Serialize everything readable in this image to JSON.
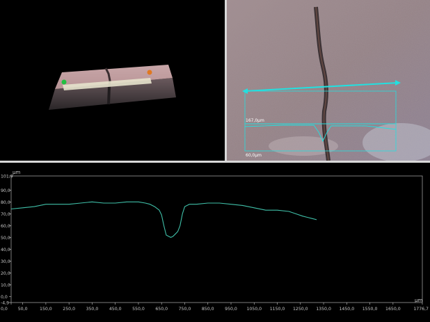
{
  "colors": {
    "profile_line": "#3fbfa8",
    "axis": "#c8c8c8",
    "measure_overlay": "#22e0e0",
    "marker_start": "#22c040",
    "marker_end": "#e07820"
  },
  "optical_view": {
    "label_width": "167,0μm",
    "label_height": "60,0μm"
  },
  "profile_chart": {
    "unit": "μm",
    "chart_data": {
      "type": "line",
      "xlim": [
        0,
        1776.7
      ],
      "ylim": [
        -4.9,
        101.9
      ],
      "x_ticks": [
        "0,0",
        "50,0",
        "150,0",
        "250,0",
        "350,0",
        "450,0",
        "550,0",
        "650,0",
        "750,0",
        "850,0",
        "950,0",
        "1050,0",
        "1150,0",
        "1250,0",
        "1350,0",
        "1450,0",
        "1550,0",
        "1650,0",
        "1776,7"
      ],
      "y_ticks": [
        "101,9",
        "90,0",
        "80,0",
        "70,0",
        "60,0",
        "50,0",
        "40,0",
        "30,0",
        "20,0",
        "10,0",
        "0,0",
        "-4,9"
      ],
      "series": [
        {
          "x": [
            0,
            50,
            100,
            150,
            200,
            250,
            300,
            350,
            400,
            450,
            500,
            550,
            580,
            600,
            620,
            640,
            650,
            660,
            670,
            680,
            690,
            700,
            710,
            720,
            730,
            740,
            750,
            770,
            800,
            850,
            900,
            950,
            1000,
            1050,
            1100,
            1150,
            1200,
            1230,
            1260,
            1280,
            1300,
            1320
          ],
          "y": [
            74,
            75,
            76,
            78,
            78,
            78,
            79,
            80,
            79,
            79,
            80,
            80,
            79,
            78,
            76,
            73,
            69,
            60,
            52,
            51,
            50,
            51,
            53,
            55,
            60,
            70,
            76,
            78,
            78,
            79,
            79,
            78,
            77,
            75,
            73,
            73,
            72,
            70,
            68,
            67,
            66,
            65
          ]
        }
      ]
    }
  }
}
